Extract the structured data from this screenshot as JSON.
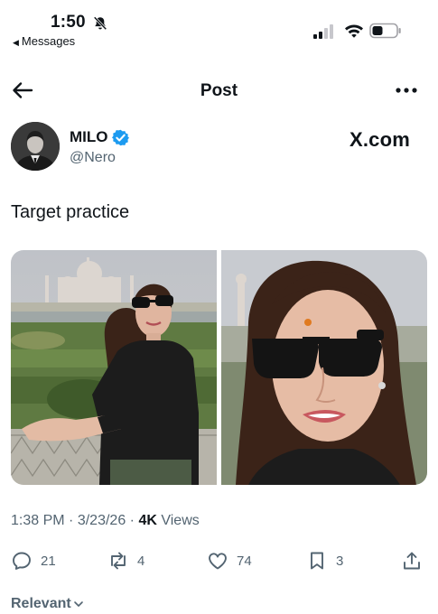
{
  "status_bar": {
    "time": "1:50",
    "back_app": "Messages"
  },
  "header": {
    "title": "Post"
  },
  "author": {
    "name": "MILO",
    "handle": "@Nero",
    "source_label": "X.com"
  },
  "post": {
    "text": "Target practice",
    "time": "1:38 PM",
    "date": "3/23/26",
    "views_count": "4K",
    "views_label": "Views"
  },
  "actions": {
    "replies": "21",
    "reposts": "4",
    "likes": "74",
    "bookmarks": "3"
  },
  "sort": {
    "label": "Relevant"
  },
  "colors": {
    "text": "#0f1419",
    "secondary": "#536471",
    "verified": "#1d9bf0"
  }
}
